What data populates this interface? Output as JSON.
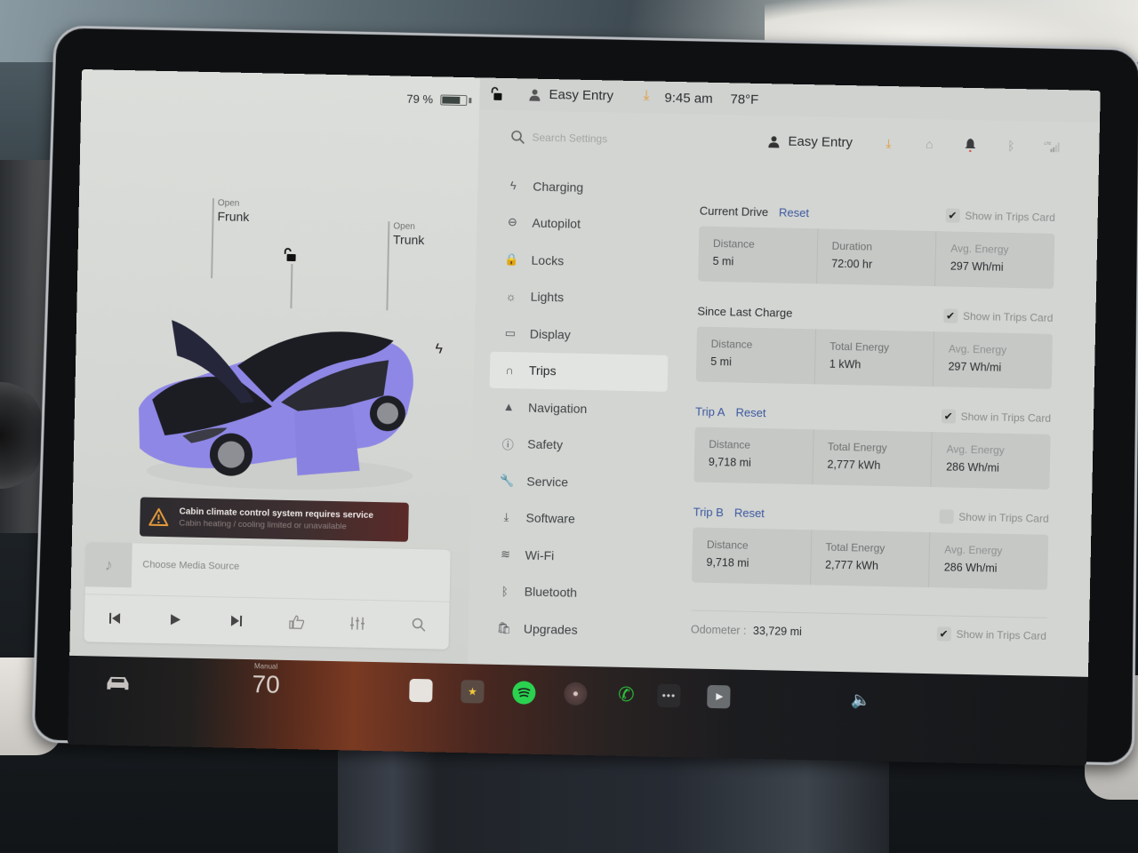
{
  "status": {
    "battery_percent": "79 %",
    "battery_level": 0.79,
    "profile_name": "Easy Entry",
    "time": "9:45 am",
    "temperature": "78°F"
  },
  "car": {
    "frunk": {
      "state": "Open",
      "label": "Frunk"
    },
    "trunk": {
      "state": "Open",
      "label": "Trunk"
    },
    "paint_color": "#8f87e6",
    "alert": {
      "title": "Cabin climate control system requires service",
      "subtitle": "Cabin heating / cooling limited or unavailable"
    }
  },
  "media": {
    "source_label": "Choose Media Source",
    "controls": [
      "previous",
      "play",
      "next",
      "thumbs-up",
      "equalizer",
      "search"
    ]
  },
  "settings": {
    "search_placeholder": "Search Settings",
    "header_profile": "Easy Entry",
    "nav": [
      {
        "label": "Charging",
        "icon": "bolt-icon"
      },
      {
        "label": "Autopilot",
        "icon": "steering-wheel-icon"
      },
      {
        "label": "Locks",
        "icon": "lock-icon"
      },
      {
        "label": "Lights",
        "icon": "lights-icon"
      },
      {
        "label": "Display",
        "icon": "display-icon"
      },
      {
        "label": "Trips",
        "icon": "trips-icon",
        "active": true
      },
      {
        "label": "Navigation",
        "icon": "navigation-icon"
      },
      {
        "label": "Safety",
        "icon": "safety-icon"
      },
      {
        "label": "Service",
        "icon": "wrench-icon"
      },
      {
        "label": "Software",
        "icon": "download-icon"
      },
      {
        "label": "Wi-Fi",
        "icon": "wifi-icon"
      },
      {
        "label": "Bluetooth",
        "icon": "bluetooth-icon"
      },
      {
        "label": "Upgrades",
        "icon": "bag-icon"
      }
    ],
    "trips": {
      "current_drive": {
        "title": "Current Drive",
        "reset": "Reset",
        "show_in_trips_card": true,
        "show_label": "Show in Trips Card",
        "stats": [
          {
            "label": "Distance",
            "value": "5 mi"
          },
          {
            "label": "Duration",
            "value": "72:00 hr"
          },
          {
            "label": "Avg. Energy",
            "value": "297 Wh/mi"
          }
        ]
      },
      "since_last_charge": {
        "title": "Since Last Charge",
        "show_in_trips_card": true,
        "show_label": "Show in Trips Card",
        "stats": [
          {
            "label": "Distance",
            "value": "5 mi"
          },
          {
            "label": "Total Energy",
            "value": "1 kWh"
          },
          {
            "label": "Avg. Energy",
            "value": "297 Wh/mi"
          }
        ]
      },
      "trip_a": {
        "title": "Trip A",
        "reset": "Reset",
        "show_in_trips_card": true,
        "show_label": "Show in Trips Card",
        "stats": [
          {
            "label": "Distance",
            "value": "9,718 mi"
          },
          {
            "label": "Total Energy",
            "value": "2,777 kWh"
          },
          {
            "label": "Avg. Energy",
            "value": "286 Wh/mi"
          }
        ]
      },
      "trip_b": {
        "title": "Trip B",
        "reset": "Reset",
        "show_in_trips_card": false,
        "show_label": "Show in Trips Card",
        "stats": [
          {
            "label": "Distance",
            "value": "9,718 mi"
          },
          {
            "label": "Total Energy",
            "value": "2,777 kWh"
          },
          {
            "label": "Avg. Energy",
            "value": "286 Wh/mi"
          }
        ]
      },
      "odometer": {
        "label": "Odometer :",
        "value": "33,729 mi",
        "show_in_trips_card": true,
        "show_label": "Show in Trips Card"
      }
    }
  },
  "dock": {
    "speed_mode": "Manual",
    "speed_value": "70",
    "apps": [
      "notes",
      "toybox",
      "spotify",
      "camera",
      "phone",
      "more",
      "theater"
    ],
    "spotify_color": "#2bd24f",
    "phone_color": "#2bc23b",
    "more_glyph": "•••"
  }
}
